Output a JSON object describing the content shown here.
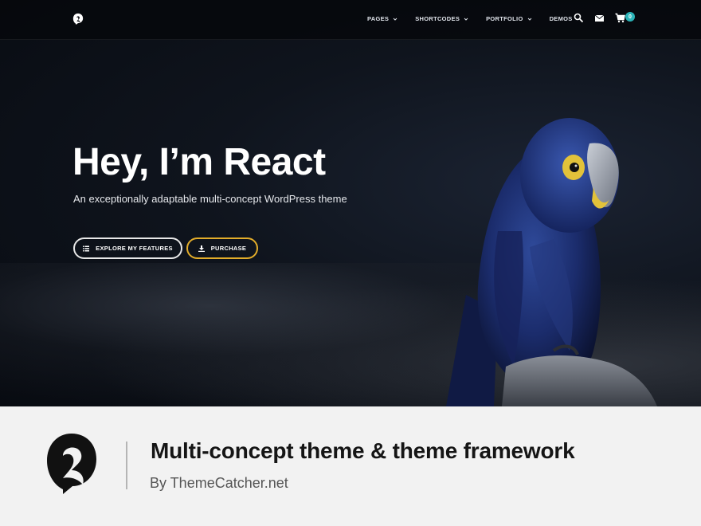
{
  "nav": {
    "items": [
      {
        "label": "PAGES",
        "has_dropdown": true
      },
      {
        "label": "SHORTCODES",
        "has_dropdown": true
      },
      {
        "label": "PORTFOLIO",
        "has_dropdown": true
      },
      {
        "label": "DEMOS",
        "has_dropdown": false
      }
    ],
    "icons": [
      "search-icon",
      "mail-icon",
      "cart-icon"
    ],
    "cart_count": "0"
  },
  "hero": {
    "title": "Hey, I’m React",
    "subtitle": "An exceptionally adaptable multi-concept WordPress theme",
    "buttons": {
      "explore_label": "EXPLORE MY FEATURES",
      "purchase_label": "PURCHASE"
    }
  },
  "banner": {
    "title": "Multi-concept theme & theme framework",
    "subtitle": "By ThemeCatcher.net"
  },
  "colors": {
    "accent_teal": "#2bb3b8",
    "accent_gold": "#e3ad2a",
    "hero_bg": "#0f141d",
    "banner_bg": "#f2f2f2"
  }
}
